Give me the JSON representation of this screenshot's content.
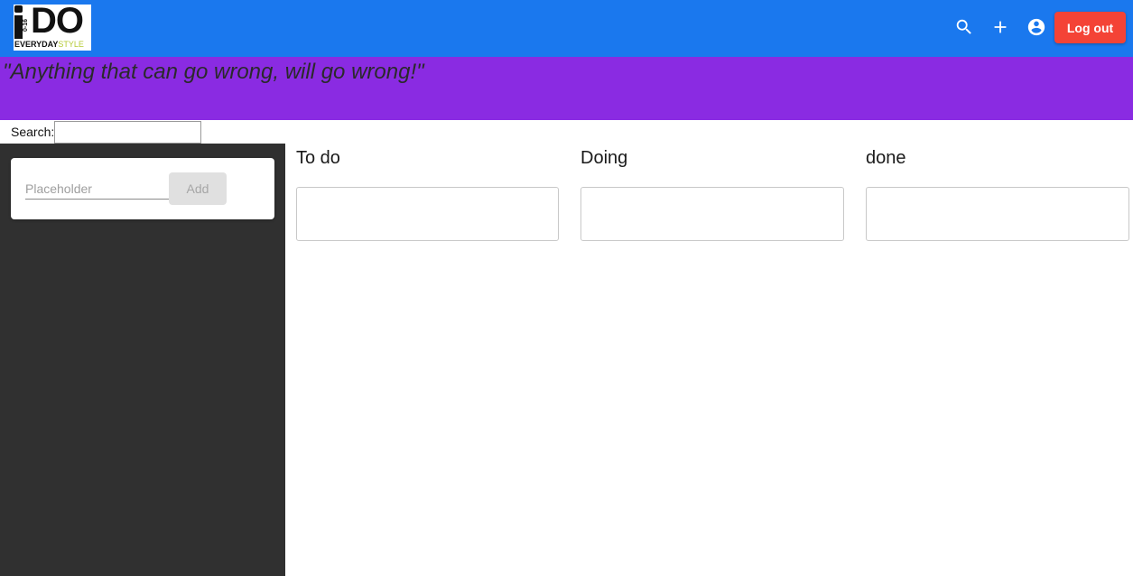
{
  "app": {
    "logo": {
      "text_main": "iDO",
      "text_age": "0-16",
      "text_everyday": "EVERYDAY",
      "text_style": "STYLE"
    },
    "icons": {
      "search": "search-icon",
      "add": "plus-icon",
      "account": "account-circle-icon"
    },
    "logout_label": "Log out",
    "colors": {
      "appbar": "#1a78ee",
      "banner": "#8a2be2",
      "logout": "#f44336",
      "sidebar": "#303030"
    }
  },
  "banner": {
    "quote": "\"Anything that can go wrong, will go wrong!\""
  },
  "search": {
    "label": "Search:",
    "value": "",
    "placeholder": ""
  },
  "sidebar": {
    "task_input": {
      "placeholder": "Placeholder",
      "value": ""
    },
    "add_label": "Add"
  },
  "board": {
    "columns": [
      {
        "title": "To do"
      },
      {
        "title": "Doing"
      },
      {
        "title": "done"
      }
    ]
  }
}
